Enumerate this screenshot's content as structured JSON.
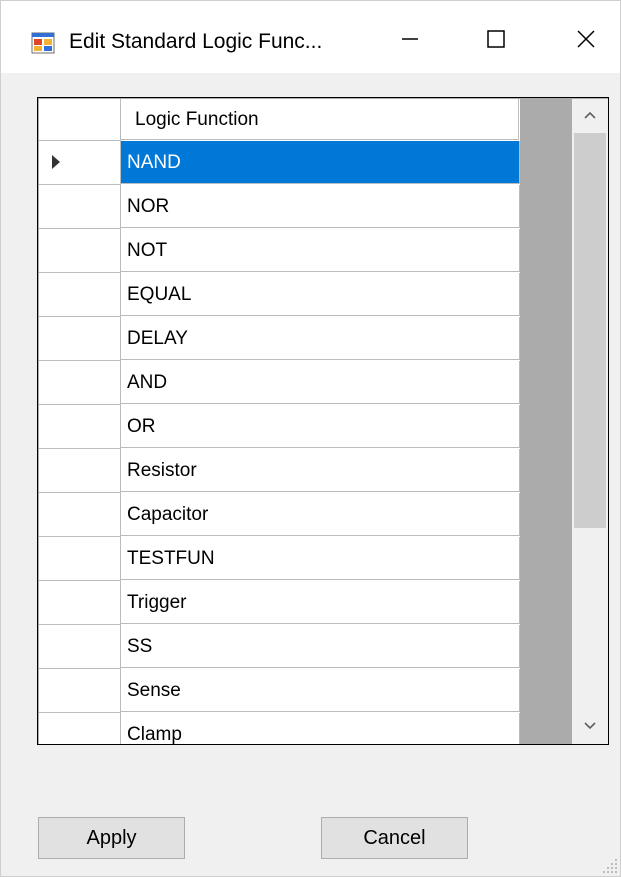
{
  "window": {
    "title": "Edit Standard Logic Func...",
    "controls": {
      "minimize": "minimize",
      "maximize": "maximize",
      "close": "close"
    }
  },
  "grid": {
    "column_header": "Logic Function",
    "selected_index": 0,
    "rows": [
      "NAND",
      "NOR",
      "NOT",
      "EQUAL",
      "DELAY",
      "AND",
      "OR",
      "Resistor",
      "Capacitor",
      "TESTFUN",
      "Trigger",
      "SS",
      "Sense",
      "Clamp"
    ]
  },
  "buttons": {
    "apply": "Apply",
    "cancel": "Cancel"
  },
  "colors": {
    "selection": "#0078d7",
    "grid_background": "#ababab"
  },
  "icons": [
    "app-form-icon",
    "minimize-icon",
    "maximize-icon",
    "close-icon",
    "scroll-up-icon",
    "scroll-down-icon",
    "size-grip-icon",
    "current-row-indicator-icon"
  ]
}
